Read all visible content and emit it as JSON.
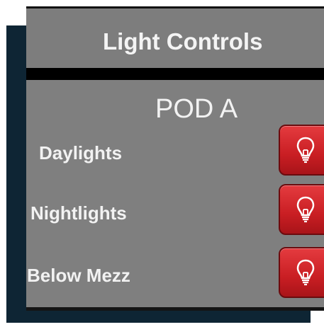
{
  "header": {
    "title": "Light Controls"
  },
  "pod": {
    "label": "POD A"
  },
  "rows": [
    {
      "label": "Daylights",
      "icon": "lightbulb-icon"
    },
    {
      "label": "Nightlights",
      "icon": "lightbulb-icon"
    },
    {
      "label": "Below Mezz",
      "icon": "lightbulb-icon"
    }
  ],
  "colors": {
    "panel": "#7f7f7f",
    "backdrop": "#0e2534",
    "button": "#d2262b",
    "text": "#f2f2f2"
  }
}
